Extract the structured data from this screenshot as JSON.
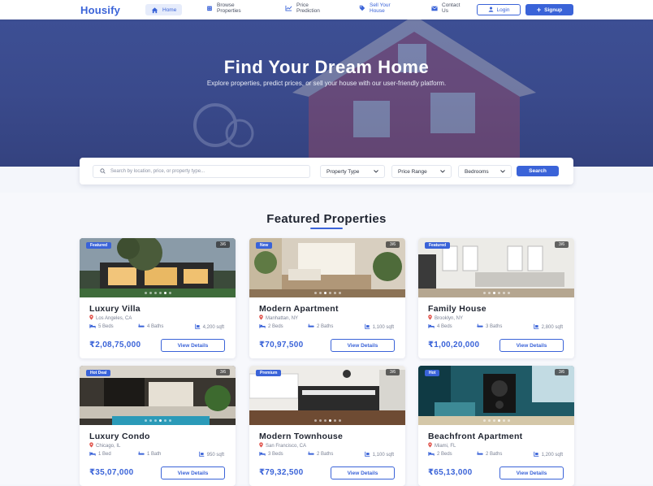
{
  "nav": {
    "logo": "Housify",
    "items": [
      {
        "label": "Home",
        "icon": "home-icon"
      },
      {
        "label": "Browse\nProperties",
        "icon": "building-icon"
      },
      {
        "label": "Price\nPrediction",
        "icon": "chart-icon"
      },
      {
        "label": "Sell Your\nHouse",
        "icon": "tag-icon"
      },
      {
        "label": "Contact\nUs",
        "icon": "mail-icon"
      }
    ],
    "login_label": "Login",
    "signup_label": "Signup"
  },
  "hero": {
    "title": "Find Your Dream Home",
    "subtitle": "Explore properties, predict prices, or sell your house with our user-friendly platform."
  },
  "search": {
    "placeholder": "Search by location, price, or property type...",
    "property_type": "Property Type",
    "price_range": "Price Range",
    "bedrooms": "Bedrooms",
    "button": "Search"
  },
  "featured": {
    "title": "Featured Properties",
    "view_details": "View Details",
    "cards": [
      {
        "badge": "Featured",
        "counter": "3/6",
        "title": "Luxury Villa",
        "location": "Los Angeles, CA",
        "beds": "5 Beds",
        "baths": "4 Baths",
        "area": "4,200 sqft",
        "price": "₹2,08,75,000"
      },
      {
        "badge": "New",
        "counter": "3/6",
        "title": "Modern Apartment",
        "location": "Manhattan, NY",
        "beds": "2 Beds",
        "baths": "2 Baths",
        "area": "1,100 sqft",
        "price": "₹70,97,500"
      },
      {
        "badge": "Featured",
        "counter": "3/6",
        "title": "Family House",
        "location": "Brooklyn, NY",
        "beds": "4 Beds",
        "baths": "3 Baths",
        "area": "2,800 sqft",
        "price": "₹1,00,20,000"
      },
      {
        "badge": "Hot Deal",
        "counter": "3/6",
        "title": "Luxury Condo",
        "location": "Chicago, IL",
        "beds": "1 Bed",
        "baths": "1 Bath",
        "area": "950 sqft",
        "price": "₹35,07,000"
      },
      {
        "badge": "Premium",
        "counter": "3/6",
        "title": "Modern Townhouse",
        "location": "San Francisco, CA",
        "beds": "3 Beds",
        "baths": "2 Baths",
        "area": "1,100 sqft",
        "price": "₹79,32,500"
      },
      {
        "badge": "Hot",
        "counter": "3/6",
        "title": "Beachfront Apartment",
        "location": "Miami, FL",
        "beds": "2 Beds",
        "baths": "2 Baths",
        "area": "1,200 sqft",
        "price": "₹65,13,000"
      }
    ]
  },
  "colors": {
    "accent": "#3a63d8",
    "hero": "#3d4f94",
    "location_pin": "#e0524a"
  }
}
